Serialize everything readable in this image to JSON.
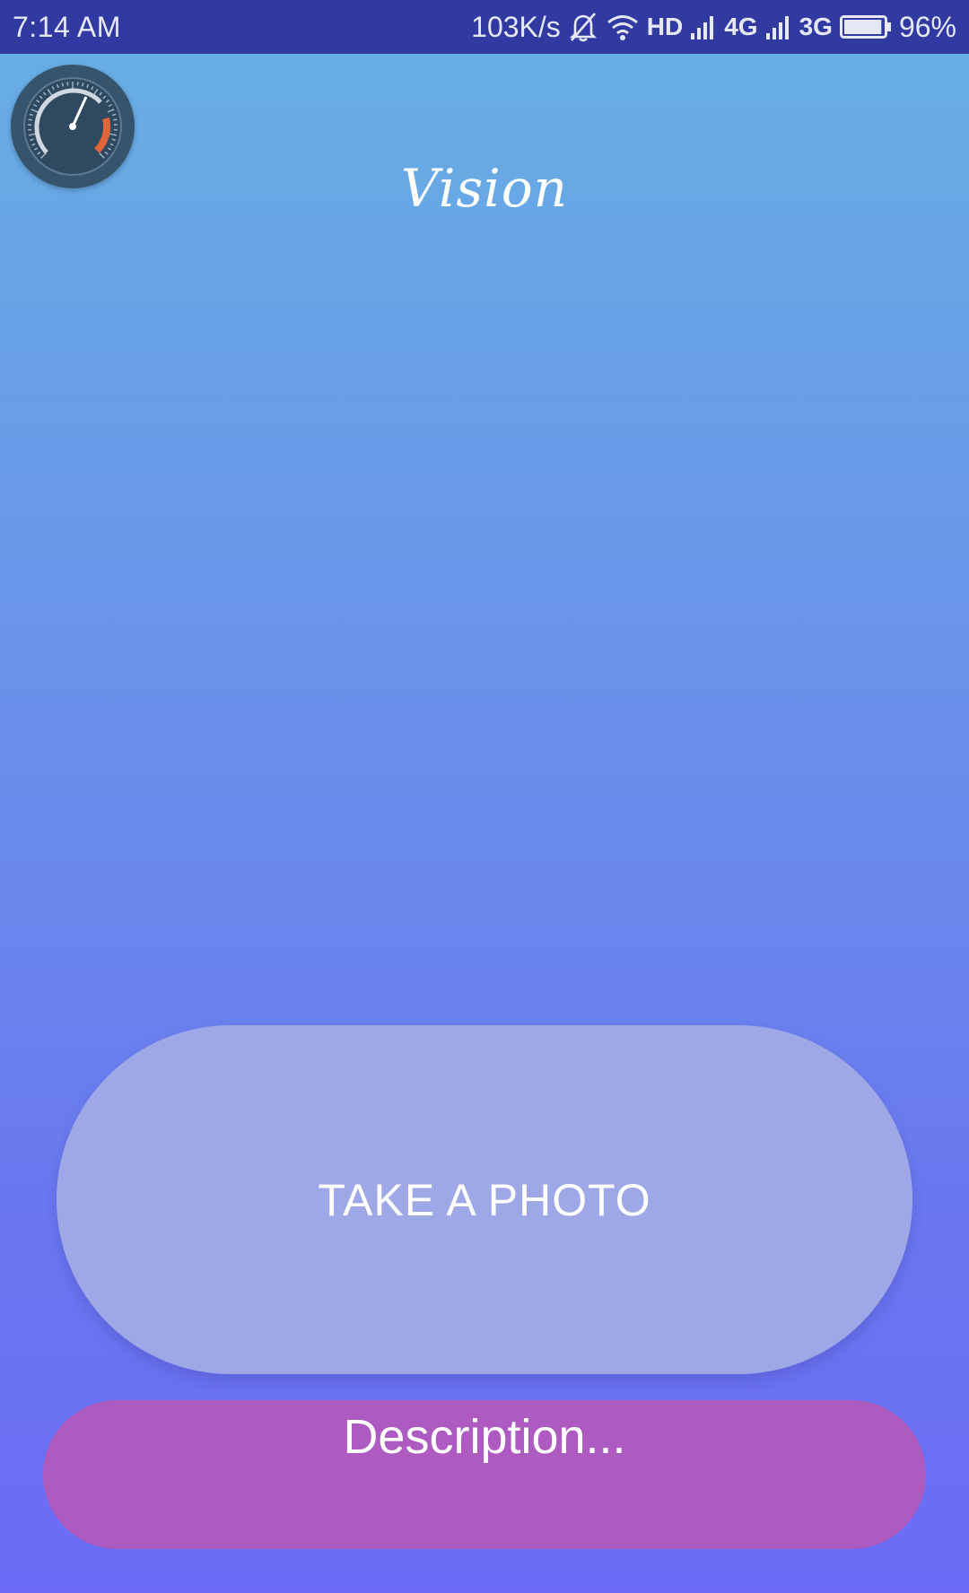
{
  "status_bar": {
    "time": "7:14 AM",
    "net_speed": "103K/s",
    "hd_label": "HD",
    "network_4g": "4G",
    "network_3g": "3G",
    "battery_percent": "96%",
    "battery_level": 0.96,
    "icons": [
      "bell-muted-icon",
      "wifi-icon",
      "signal-icon",
      "signal-icon",
      "battery-icon"
    ]
  },
  "widget": {
    "icon": "speedometer-icon"
  },
  "app": {
    "logo_text": "Vision"
  },
  "main": {
    "take_photo_label": "TAKE A PHOTO",
    "description_placeholder": "Description..."
  },
  "colors": {
    "status_bar": "#303aa0",
    "gradient_top": "#67b0e3",
    "gradient_bottom": "#6b6bf5",
    "take_photo_button": "#9ea8e6",
    "description_field": "#ad5bc1"
  }
}
